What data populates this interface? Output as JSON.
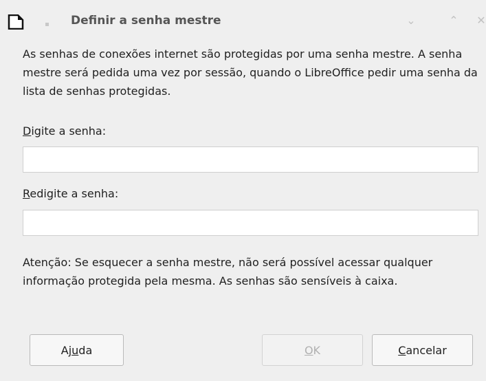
{
  "window": {
    "title": "Definir a senha mestre",
    "app_icon": "libreoffice-document-icon",
    "controls": [
      "minimize-icon",
      "maximize-icon",
      "close-icon"
    ]
  },
  "intro_text": "As senhas de conexões internet são protegidas por uma senha mestre. A senha mestre será pedida uma vez por sessão, quando o LibreOffice pedir uma senha da lista de senhas protegidas.",
  "password_field": {
    "label_first": "D",
    "label_rest": "igite a senha:",
    "value": ""
  },
  "confirm_field": {
    "label_first": "R",
    "label_rest": "edigite a senha:",
    "value": ""
  },
  "warning_text": "Atenção: Se esquecer a senha mestre, não será possível acessar qualquer informação protegida pela mesma. As senhas são sensíveis à caixa.",
  "buttons": {
    "help": {
      "before": "Aj",
      "mnemonic": "u",
      "after": "da"
    },
    "ok": {
      "before": "",
      "mnemonic": "O",
      "after": "K",
      "enabled": false
    },
    "cancel": {
      "before": "",
      "mnemonic": "C",
      "after": "ancelar"
    }
  }
}
